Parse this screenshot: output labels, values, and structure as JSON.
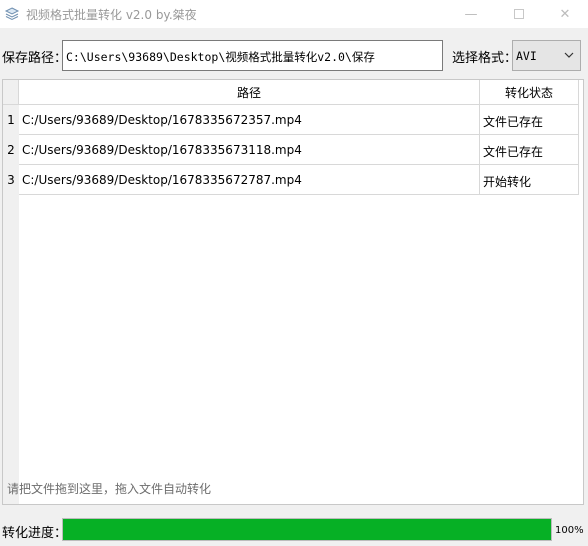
{
  "window": {
    "title": "视频格式批量转化 v2.0 by.桀夜",
    "minimize_glyph": "—",
    "close_glyph": "✕",
    "icon": "layers-icon"
  },
  "save_path": {
    "label": "保存路径：",
    "value": "C:\\Users\\93689\\Desktop\\视频格式批量转化v2.0\\保存"
  },
  "format": {
    "label": "选择格式：",
    "selected": "AVI"
  },
  "table": {
    "columns": [
      "路径",
      "转化状态"
    ],
    "rows": [
      {
        "num": "1",
        "path": "C:/Users/93689/Desktop/1678335672357.mp4",
        "status": "文件已存在"
      },
      {
        "num": "2",
        "path": "C:/Users/93689/Desktop/1678335673118.mp4",
        "status": "文件已存在"
      },
      {
        "num": "3",
        "path": "C:/Users/93689/Desktop/1678335672787.mp4",
        "status": "开始转化"
      }
    ]
  },
  "hint": "请把文件拖到这里，拖入文件自动转化",
  "progress": {
    "label": "转化进度：",
    "value": 100,
    "text": "100%",
    "color": "#06b025"
  }
}
